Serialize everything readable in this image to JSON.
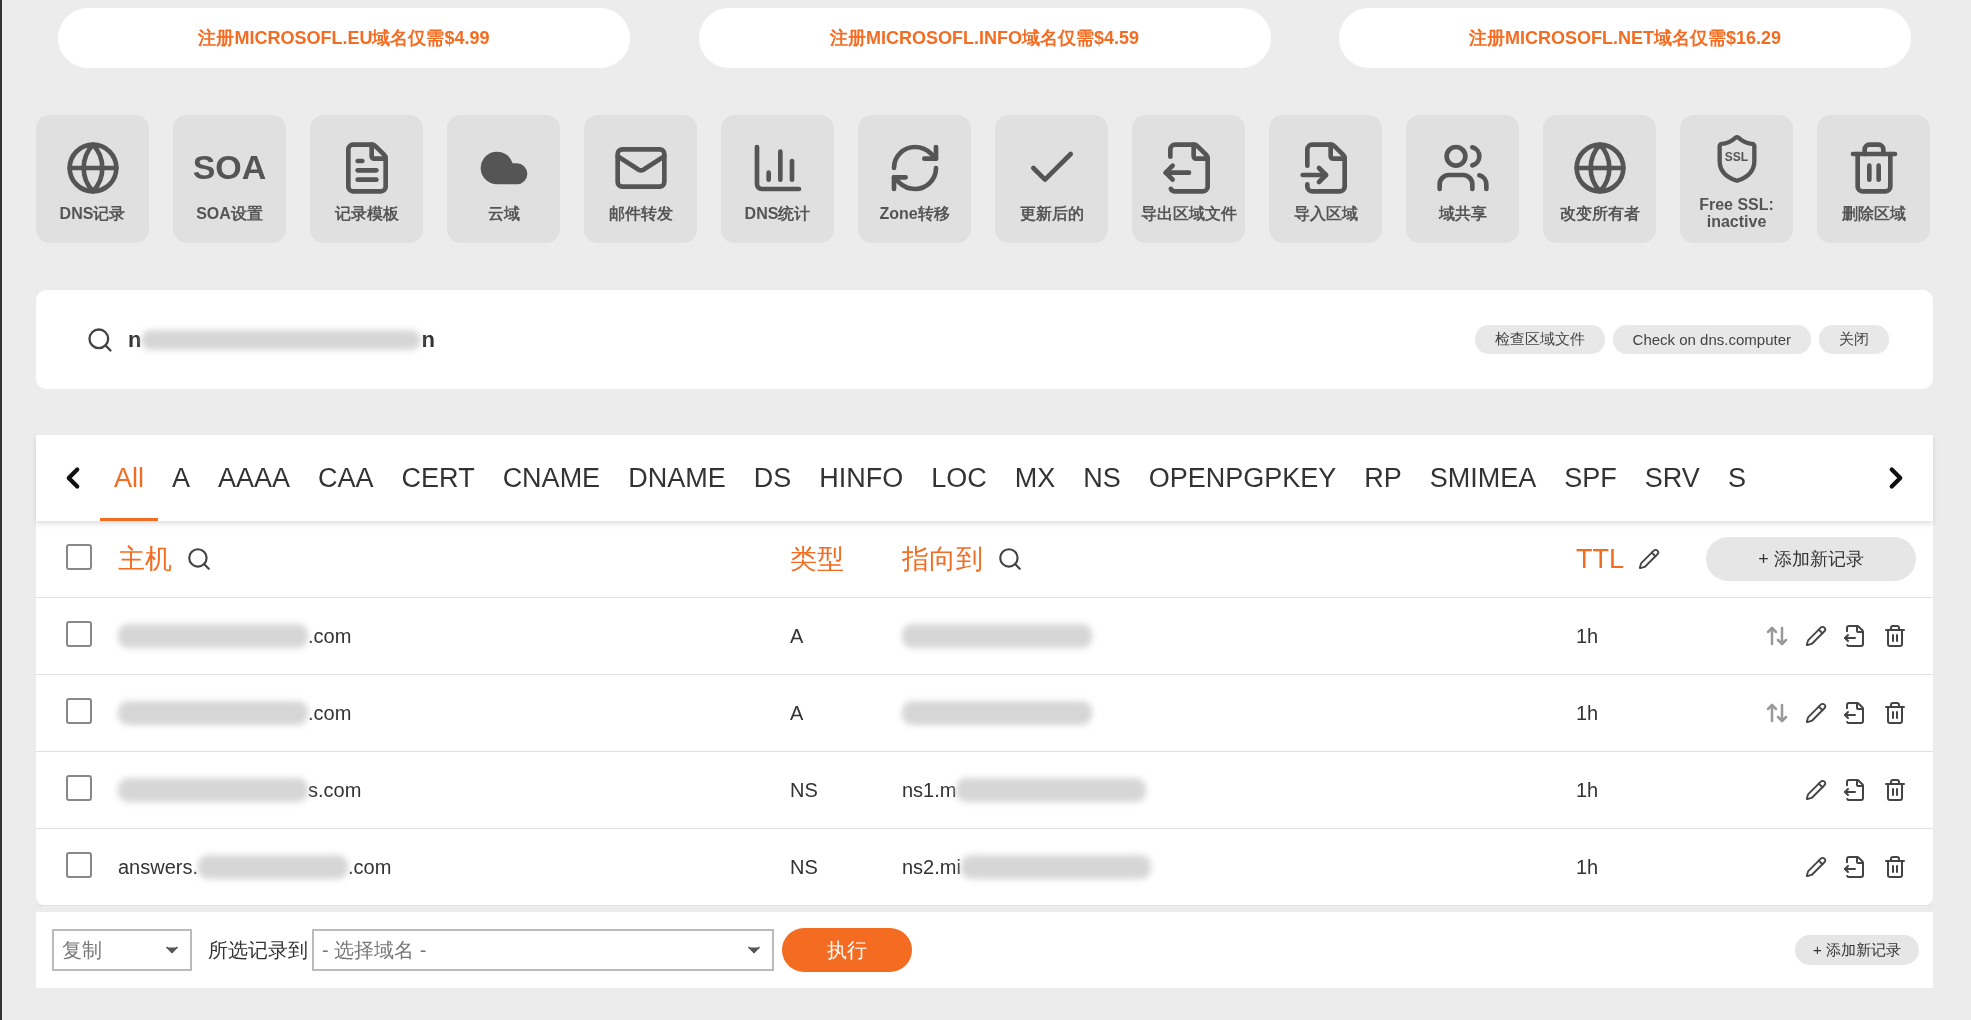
{
  "banners": [
    "注册MICROSOFL.EU域名仅需$4.99",
    "注册MICROSOFL.INFO域名仅需$4.59",
    "注册MICROSOFL.NET域名仅需$16.29"
  ],
  "tools": [
    {
      "label": "DNS记录"
    },
    {
      "label": "SOA设置",
      "glyph": "SOA"
    },
    {
      "label": "记录模板"
    },
    {
      "label": "云域"
    },
    {
      "label": "邮件转发"
    },
    {
      "label": "DNS统计"
    },
    {
      "label": "Zone转移"
    },
    {
      "label": "更新后的"
    },
    {
      "label": "导出区域文件"
    },
    {
      "label": "导入区域"
    },
    {
      "label": "域共享"
    },
    {
      "label": "改变所有者"
    },
    {
      "label": "Free SSL: inactive",
      "glyph": "SSL"
    },
    {
      "label": "删除区域"
    }
  ],
  "search": {
    "value_prefix": "n",
    "value_suffix": "n",
    "buttons": [
      "检查区域文件",
      "Check on dns.computer",
      "关闭"
    ]
  },
  "record_tabs": [
    {
      "label": "All",
      "selected": true
    },
    {
      "label": "A",
      "selected": false
    },
    {
      "label": "AAAA",
      "selected": false
    },
    {
      "label": "CAA",
      "selected": false
    },
    {
      "label": "CERT",
      "selected": false
    },
    {
      "label": "CNAME",
      "selected": false
    },
    {
      "label": "DNAME",
      "selected": false
    },
    {
      "label": "DS",
      "selected": false
    },
    {
      "label": "HINFO",
      "selected": false
    },
    {
      "label": "LOC",
      "selected": false
    },
    {
      "label": "MX",
      "selected": false
    },
    {
      "label": "NS",
      "selected": false
    },
    {
      "label": "OPENPGPKEY",
      "selected": false
    },
    {
      "label": "RP",
      "selected": false
    },
    {
      "label": "SMIMEA",
      "selected": false
    },
    {
      "label": "SPF",
      "selected": false
    },
    {
      "label": "SRV",
      "selected": false
    },
    {
      "label": "S",
      "selected": false
    }
  ],
  "table": {
    "columns": [
      "主机",
      "类型",
      "指向到",
      "TTL"
    ],
    "add_button": "+ 添加新记录",
    "select_all_checked": false,
    "rows": [
      {
        "checked": false,
        "host_prefix": "",
        "host_suffix": ".com",
        "type": "A",
        "target_prefix": "",
        "ttl": "1h",
        "reorderable": true
      },
      {
        "checked": false,
        "host_prefix": "",
        "host_suffix": ".com",
        "type": "A",
        "target_prefix": "",
        "ttl": "1h",
        "reorderable": true
      },
      {
        "checked": false,
        "host_prefix": "",
        "host_suffix": "s.com",
        "type": "NS",
        "target_prefix": "ns1.m",
        "ttl": "1h",
        "reorderable": false
      },
      {
        "checked": false,
        "host_prefix": "answers.",
        "host_suffix": ".com",
        "type": "NS",
        "target_prefix": "ns2.mi",
        "ttl": "1h",
        "reorderable": false
      }
    ]
  },
  "footer": {
    "action_select": "复制",
    "label": "所选记录到",
    "domain_select": "- 选择域名 -",
    "run_button": "执行",
    "add_button": "+ 添加新记录"
  }
}
